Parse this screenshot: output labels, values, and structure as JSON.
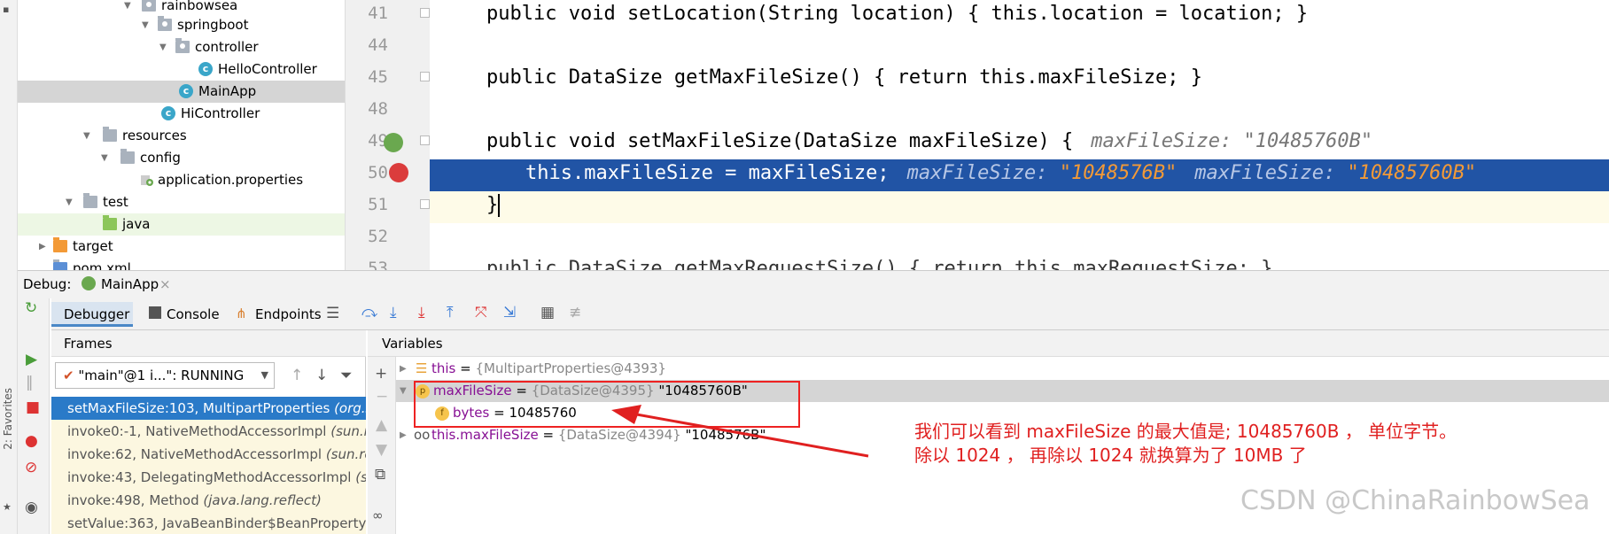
{
  "tree": {
    "items": [
      {
        "label": "rainbowsea",
        "kind": "package"
      },
      {
        "label": "springboot",
        "kind": "package"
      },
      {
        "label": "controller",
        "kind": "package"
      },
      {
        "label": "HelloController",
        "kind": "class"
      },
      {
        "label": "MainApp",
        "kind": "class"
      },
      {
        "label": "HiController",
        "kind": "class"
      },
      {
        "label": "resources",
        "kind": "folder"
      },
      {
        "label": "config",
        "kind": "folder"
      },
      {
        "label": "application.properties",
        "kind": "properties"
      },
      {
        "label": "test",
        "kind": "folder"
      },
      {
        "label": "java",
        "kind": "folder"
      },
      {
        "label": "target",
        "kind": "folder"
      },
      {
        "label": "pom.xml",
        "kind": "file"
      }
    ]
  },
  "editor": {
    "lines": [
      {
        "num": "41",
        "code": "public void setLocation(String location) { this.location = location; }"
      },
      {
        "num": "44",
        "code": ""
      },
      {
        "num": "45",
        "code": "public DataSize getMaxFileSize() { return this.maxFileSize; }"
      },
      {
        "num": "48",
        "code": ""
      },
      {
        "num": "49",
        "code": "public void setMaxFileSize(DataSize maxFileSize) {",
        "hint": "maxFileSize: \"10485760B\""
      },
      {
        "num": "50",
        "code": "this.maxFileSize = maxFileSize;",
        "hint1": "maxFileSize: ",
        "hint1v": "\"1048576B\"",
        "hint2": "maxFileSize: ",
        "hint2v": "\"10485760B\""
      },
      {
        "num": "51",
        "code": "}"
      },
      {
        "num": "52",
        "code": ""
      },
      {
        "num": "53",
        "code": "public DataSize getMaxRequestSize() { return this.maxRequestSize; }"
      }
    ]
  },
  "debug": {
    "label": "Debug:",
    "session": "MainApp",
    "tabs": [
      "Debugger",
      "Console",
      "Endpoints"
    ],
    "frames_title": "Frames",
    "thread": "\"main\"@1 i...\": RUNNING",
    "frames": [
      {
        "method": "setMaxFileSize:103, MultipartProperties",
        "pkg": "(org.s"
      },
      {
        "method": "invoke0:-1, NativeMethodAccessorImpl",
        "pkg": "(sun.re"
      },
      {
        "method": "invoke:62, NativeMethodAccessorImpl",
        "pkg": "(sun.re"
      },
      {
        "method": "invoke:43, DelegatingMethodAccessorImpl",
        "pkg": "(su"
      },
      {
        "method": "invoke:498, Method",
        "pkg": "(java.lang.reflect)"
      },
      {
        "method": "setValue:363, JavaBeanBinder$BeanProperty",
        "pkg": "(c"
      }
    ],
    "variables_title": "Variables",
    "variables": [
      {
        "name": "this",
        "eq": " = ",
        "type": "{MultipartProperties@4393}",
        "value": ""
      },
      {
        "name": "maxFileSize",
        "eq": " = ",
        "type": "{DataSize@4395}",
        "value": " \"10485760B\""
      },
      {
        "name": "bytes",
        "eq": " = ",
        "type": "",
        "value": "10485760"
      },
      {
        "name": "this.maxFileSize",
        "eq": " = ",
        "type": "{DataSize@4394}",
        "value": " \"1048576B\""
      }
    ]
  },
  "annotation": {
    "line1": "我们可以看到 maxFileSize 的最大值是; 10485760B ， 单位字节。",
    "line2": "除以 1024 ， 再除以 1024 就换算为了 10MB 了"
  },
  "watermark": "CSDN @ChinaRainbowSea",
  "sidebar_label": "2: Favorites"
}
